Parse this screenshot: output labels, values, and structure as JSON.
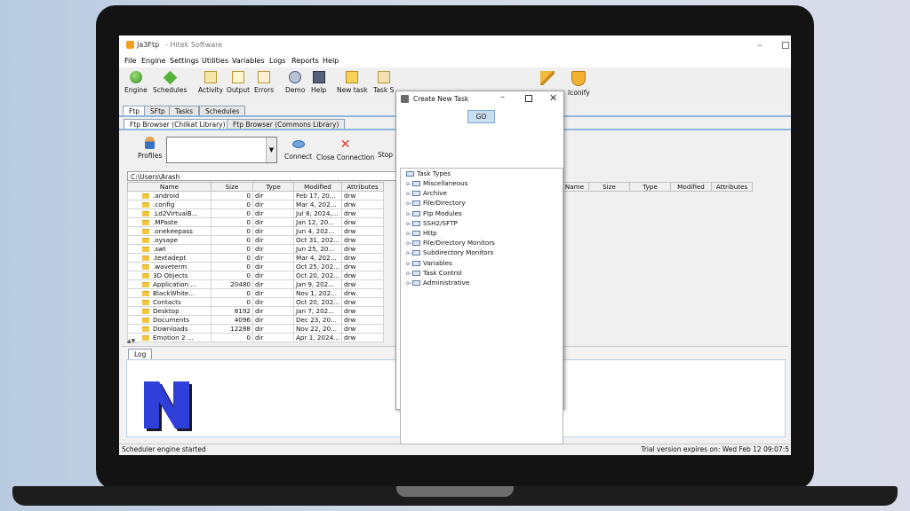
{
  "window": {
    "title": "Ja3Ftp",
    "subtitle": "- Hitek Software"
  },
  "menu": [
    "File",
    "Engine",
    "Settings",
    "Utilities",
    "Variables",
    "Logs",
    "Reports",
    "Help"
  ],
  "toolbar": [
    {
      "label": "Engine",
      "icon": "engine-icon"
    },
    {
      "label": "Schedules",
      "icon": "schedules-icon"
    },
    {
      "label": "Activity",
      "icon": "activity-icon"
    },
    {
      "label": "Output",
      "icon": "output-icon"
    },
    {
      "label": "Errors",
      "icon": "errors-icon"
    },
    {
      "label": "Demo",
      "icon": "demo-icon"
    },
    {
      "label": "Help",
      "icon": "help-book-icon"
    },
    {
      "label": "New task",
      "icon": "new-task-icon"
    },
    {
      "label": "Task S",
      "icon": "task-scheduler-icon"
    },
    {
      "label": "",
      "icon": "wrench-icon"
    },
    {
      "label": "Iconify",
      "icon": "iconify-shield-icon"
    }
  ],
  "main_tabs": [
    "Ftp",
    "SFtp",
    "Tasks",
    "Schedules"
  ],
  "browser_tabs": [
    "Ftp Browser (Chilkat Library)",
    "Ftp Browser (Commons Library)"
  ],
  "ftp_toolbar": {
    "profiles": "Profiles",
    "connect": "Connect",
    "close_connection": "Close Connection",
    "stop": "Stop"
  },
  "local_path": "C:\\Users\\Arash",
  "file_table": {
    "columns": [
      "Name",
      "Size",
      "Type",
      "Modified",
      "Attributes"
    ],
    "rows": [
      [
        ".android",
        "0",
        "dir",
        "Feb 17, 20...",
        "drw"
      ],
      [
        ".config",
        "0",
        "dir",
        "Mar 4, 202...",
        "drw"
      ],
      [
        ".Ld2VirtualB...",
        "0",
        "dir",
        "Jul 8, 2024,...",
        "drw"
      ],
      [
        ".MPaste",
        "0",
        "dir",
        "Jan 12, 20...",
        "drw"
      ],
      [
        ".onekeepass",
        "0",
        "dir",
        "Jun 4, 202...",
        "drw"
      ],
      [
        ".oysape",
        "0",
        "dir",
        "Oct 31, 202...",
        "drw"
      ],
      [
        ".swt",
        "0",
        "dir",
        "Jun 25, 20...",
        "drw"
      ],
      [
        ".textadept",
        "0",
        "dir",
        "Mar 4, 202...",
        "drw"
      ],
      [
        ".waveterm",
        "0",
        "dir",
        "Oct 25, 202...",
        "drw"
      ],
      [
        "3D Objects",
        "0",
        "dir",
        "Oct 20, 202...",
        "drw"
      ],
      [
        "Application ...",
        "20480",
        "dir",
        "Jan 9, 202...",
        "drw"
      ],
      [
        "BlackWhite...",
        "0",
        "dir",
        "Nov 1, 202...",
        "drw"
      ],
      [
        "Contacts",
        "0",
        "dir",
        "Oct 20, 202...",
        "drw"
      ],
      [
        "Desktop",
        "8192",
        "dir",
        "Jan 7, 202...",
        "drw"
      ],
      [
        "Documents",
        "4096",
        "dir",
        "Dec 23, 20...",
        "drw"
      ],
      [
        "Downloads",
        "12288",
        "dir",
        "Nov 22, 20...",
        "drw"
      ],
      [
        "Emotion 2 ...",
        "0",
        "dir",
        "Apr 1, 2024...",
        "drw"
      ]
    ]
  },
  "remote_table": {
    "columns": [
      "Name",
      "Size",
      "Type",
      "Modified",
      "Attributes"
    ]
  },
  "log_tab": "Log",
  "status": {
    "left": "Scheduler engine started",
    "right": "Trial version expires on: Wed Feb 12 09:07:5"
  },
  "dialog": {
    "title": "Create New Task",
    "go": "GO",
    "root": "Task Types",
    "items": [
      "Miscellaneous",
      "Archive",
      "File/Directory",
      "Ftp Modules",
      "SSH2/SFTP",
      "Http",
      "File/Directory Monitors",
      "Subdirectory Monitors",
      "Variables",
      "Task Control",
      "Administrative"
    ]
  },
  "colors": {
    "watermark": "#2f3dd9",
    "tab_rule": "#8fb6de",
    "selected": "#c9e0f3"
  }
}
